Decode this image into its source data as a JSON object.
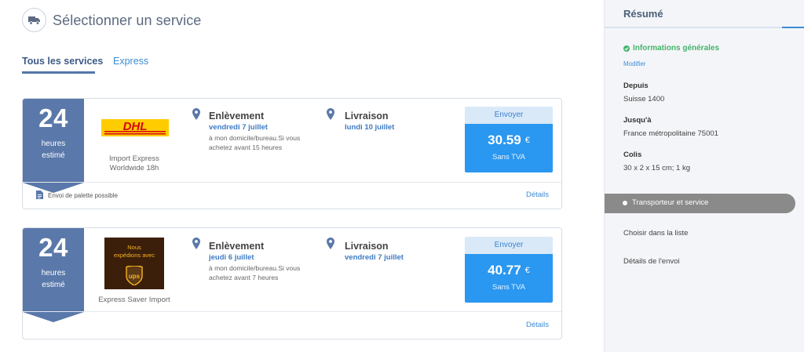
{
  "header": {
    "title": "Sélectionner un service",
    "icon": "truck-icon"
  },
  "tabs": [
    {
      "label": "Tous les services",
      "active": true
    },
    {
      "label": "Express",
      "active": false
    }
  ],
  "colors": {
    "accent": "#2a97f0",
    "ribbon": "#5a78a9",
    "success": "#45b46a",
    "dhl_yellow": "#ffcc00",
    "dhl_red": "#d40511",
    "ups_brown": "#3b1f0a"
  },
  "cards": [
    {
      "ribbon": {
        "number": "24",
        "line1": "heures",
        "line2": "estimé"
      },
      "carrier": {
        "logo": "DHL",
        "name_line1": "Import Express",
        "name_line2": "Worldwide 18h"
      },
      "pickup": {
        "title": "Enlèvement",
        "date": "vendredi 7 juillet",
        "desc_line1": "à mon domicile/bureau.Si vous",
        "desc_line2": "achetez avant 15 heures"
      },
      "delivery": {
        "title": "Livraison",
        "date": "lundi 10 juillet"
      },
      "price": {
        "button": "Envoyer",
        "amount": "30.59",
        "currency": "€",
        "tax": "Sans TVA"
      },
      "footer_note": "Envoi de palette possible",
      "details": "Détails"
    },
    {
      "ribbon": {
        "number": "24",
        "line1": "heures",
        "line2": "estimé"
      },
      "carrier": {
        "logo_line1": "Nous",
        "logo_line2": "expédions avec",
        "logo_mark": "ups",
        "name_line1": "Express Saver Import"
      },
      "pickup": {
        "title": "Enlèvement",
        "date": "jeudi 6 juillet",
        "desc_line1": "à mon domicile/bureau.Si vous",
        "desc_line2": "achetez avant 7 heures"
      },
      "delivery": {
        "title": "Livraison",
        "date": "vendredi 7 juillet"
      },
      "price": {
        "button": "Envoyer",
        "amount": "40.77",
        "currency": "€",
        "tax": "Sans TVA"
      },
      "details": "Détails"
    }
  ],
  "sidebar": {
    "title": "Résumé",
    "general_info": "Informations générales",
    "modify": "Modifier",
    "from_label": "Depuis",
    "from_value": "Suisse 1400",
    "to_label": "Jusqu'à",
    "to_value": "France métropolitaine 75001",
    "parcel_label": "Colis",
    "parcel_value": "30 x 2 x 15 cm; 1 kg",
    "active_step": "Transporteur et service",
    "step_choose": "Choisir dans la liste",
    "step_details": "Détails de l'envoi"
  }
}
